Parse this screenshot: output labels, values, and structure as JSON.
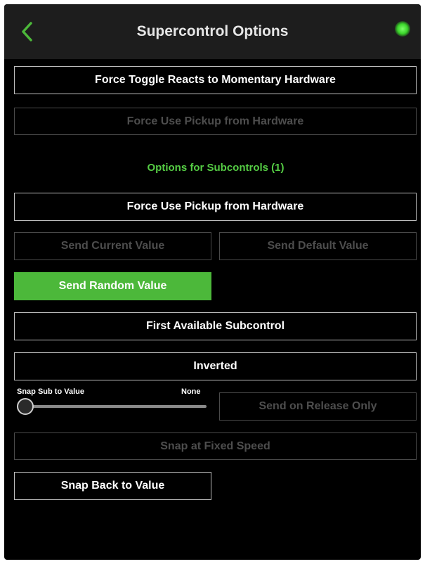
{
  "header": {
    "title": "Supercontrol Options",
    "back_icon": "chevron-left-icon",
    "status_color": "#3ad42a"
  },
  "colors": {
    "accent": "#4cb83a",
    "section_label": "#55cc44",
    "background": "#000000",
    "header_background": "#1d1d1d"
  },
  "buttons": {
    "force_toggle": "Force Toggle Reacts to Momentary Hardware",
    "force_pickup_disabled": "Force Use Pickup from Hardware",
    "force_pickup_sub": "Force Use Pickup from Hardware",
    "send_current": "Send Current Value",
    "send_default": "Send Default Value",
    "send_random": "Send Random Value",
    "first_available": "First Available Subcontrol",
    "inverted": "Inverted",
    "send_on_release": "Send on Release Only",
    "snap_fixed_speed": "Snap at Fixed Speed",
    "snap_back": "Snap Back to Value"
  },
  "section": {
    "subcontrols_label": "Options for Subcontrols (1)"
  },
  "slider": {
    "label": "Snap Sub to Value",
    "value_text": "None",
    "position_fraction": 0
  }
}
